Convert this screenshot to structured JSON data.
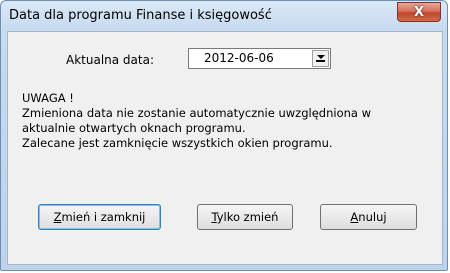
{
  "window": {
    "title": "Data dla programu Finanse i księgowość",
    "close_glyph": "X"
  },
  "date": {
    "label": "Aktualna data:",
    "value": "2012-06-06"
  },
  "message": {
    "line1": "UWAGA !",
    "line2": "Zmieniona data nie zostanie automatycznie uwzględniona w",
    "line3": "aktualnie otwartych oknach programu.",
    "line4": "Zalecane jest zamknięcie wszystkich okien programu."
  },
  "buttons": {
    "change_close": "Zmień i zamknij",
    "change_only": "Tylko zmień",
    "cancel": "Anuluj"
  },
  "colors": {
    "title_bar": "#c6daf0",
    "close_button": "#c7503a",
    "client_area": "#f0f0f0"
  },
  "icons": {
    "close": "close-icon",
    "dropdown": "chevron-down-icon"
  }
}
